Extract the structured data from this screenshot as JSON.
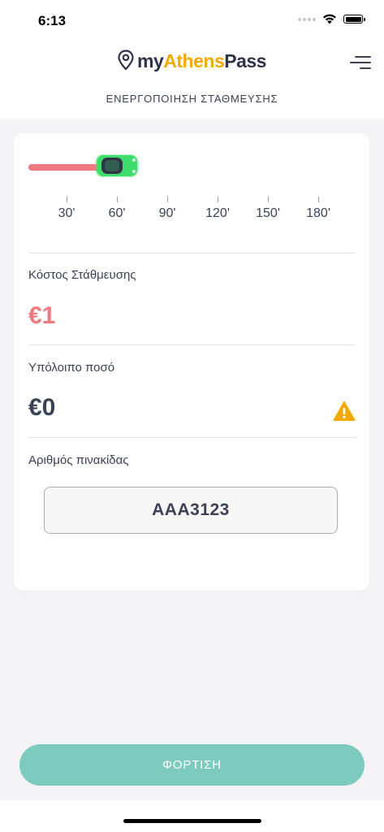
{
  "status_bar": {
    "time": "6:13"
  },
  "header": {
    "logo": {
      "my": "my",
      "athens": "Athens",
      "pass": "Pass"
    },
    "subtitle": "ΕΝΕΡΓΟΠΟΙΗΣΗ ΣΤΑΘΜΕΥΣΗΣ",
    "menu_icon": "menu-icon"
  },
  "duration_slider": {
    "selected_minutes": 60,
    "min_minutes": 30,
    "max_minutes": 180,
    "ticks": [
      "30'",
      "60'",
      "90'",
      "120'",
      "150'",
      "180'"
    ],
    "thumb_icon": "car-icon",
    "track_color": "#ee7a80",
    "thumb_color": "#3ddc6b"
  },
  "cost": {
    "label": "Κόστος Στάθμευσης",
    "value": "€1",
    "color": "#ee7a80"
  },
  "balance": {
    "label": "Υπόλοιπο ποσό",
    "value": "€0",
    "warning_icon": "warning-icon",
    "warning_color": "#f2a900"
  },
  "plate": {
    "label": "Αριθμός πινακίδας",
    "value": "AAA3123"
  },
  "charge_button": {
    "label": "ΦΟΡΤΙΣΗ",
    "color": "#7dcabf"
  }
}
